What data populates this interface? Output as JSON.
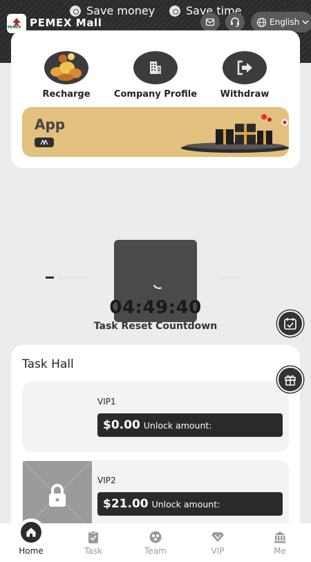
{
  "header": {
    "slogans": [
      "Save money",
      "Save time"
    ],
    "logo_text": "PEMEX",
    "app_name": "PEMEX Mall",
    "language": "English"
  },
  "quick_actions": [
    {
      "label": "Recharge",
      "icon": "gold-coins-icon"
    },
    {
      "label": "Company Profile",
      "icon": "building-icon"
    },
    {
      "label": "Withdraw",
      "icon": "exit-arrow-icon"
    }
  ],
  "banner": {
    "title": "App"
  },
  "countdown": {
    "time": "04:49:40",
    "label": "Task Reset Countdown"
  },
  "task_hall": {
    "title": "Task Hall",
    "cards": [
      {
        "level": "VIP1",
        "amount": "$0.00",
        "unlock_label": "Unlock amount:",
        "locked": false
      },
      {
        "level": "VIP2",
        "amount": "$21.00",
        "unlock_label": "Unlock amount:",
        "locked": true
      }
    ]
  },
  "tabbar": [
    {
      "label": "Home",
      "icon": "home-icon",
      "active": true
    },
    {
      "label": "Task",
      "icon": "clipboard-check-icon",
      "active": false
    },
    {
      "label": "Team",
      "icon": "team-icon",
      "active": false
    },
    {
      "label": "VIP",
      "icon": "diamond-icon",
      "active": false
    },
    {
      "label": "Me",
      "icon": "bank-icon",
      "active": false
    }
  ],
  "colors": {
    "dark": "#2a2a2c",
    "gold": "#e2c07e",
    "background": "#ececec"
  }
}
